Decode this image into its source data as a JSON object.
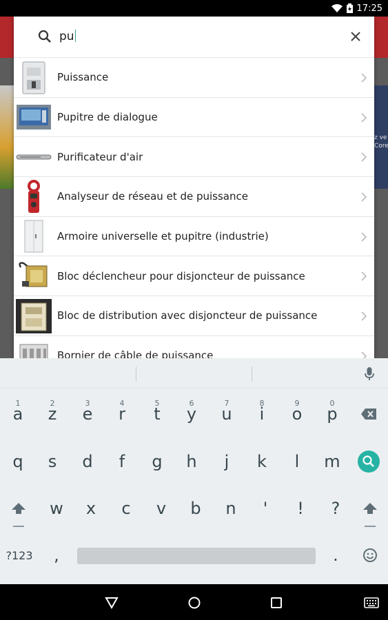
{
  "status_bar": {
    "time": "17:25"
  },
  "background_app": {
    "side_text_lines": [
      "z ve",
      "Core"
    ]
  },
  "search": {
    "query": "pu"
  },
  "results": [
    {
      "label": "Puissance",
      "thumb": "circuit-breaker-icon"
    },
    {
      "label": "Pupitre de dialogue",
      "thumb": "operator-panel-icon"
    },
    {
      "label": "Purificateur d'air",
      "thumb": "air-purifier-icon"
    },
    {
      "label": "Analyseur de réseau et de puissance",
      "thumb": "clamp-meter-icon"
    },
    {
      "label": "Armoire universelle et pupitre (industrie)",
      "thumb": "cabinet-icon"
    },
    {
      "label": "Bloc déclencheur pour disjoncteur de puissance",
      "thumb": "trip-unit-icon"
    },
    {
      "label": "Bloc de distribution avec disjoncteur de puissance",
      "thumb": "distribution-block-icon"
    },
    {
      "label": "Bornier de câble de puissance",
      "thumb": "terminal-block-icon"
    }
  ],
  "keyboard": {
    "row1": [
      {
        "key": "a",
        "hint": "1"
      },
      {
        "key": "z",
        "hint": "2"
      },
      {
        "key": "e",
        "hint": "3"
      },
      {
        "key": "r",
        "hint": "4"
      },
      {
        "key": "t",
        "hint": "5"
      },
      {
        "key": "y",
        "hint": "6"
      },
      {
        "key": "u",
        "hint": "7"
      },
      {
        "key": "i",
        "hint": "8"
      },
      {
        "key": "o",
        "hint": "9"
      },
      {
        "key": "p",
        "hint": "0"
      }
    ],
    "row2": [
      "q",
      "s",
      "d",
      "f",
      "g",
      "h",
      "j",
      "k",
      "l",
      "m"
    ],
    "row3": [
      "w",
      "x",
      "c",
      "v",
      "b",
      "n",
      "'",
      "!",
      "?"
    ],
    "symbols_label": "?123",
    "comma": ",",
    "period": "."
  }
}
